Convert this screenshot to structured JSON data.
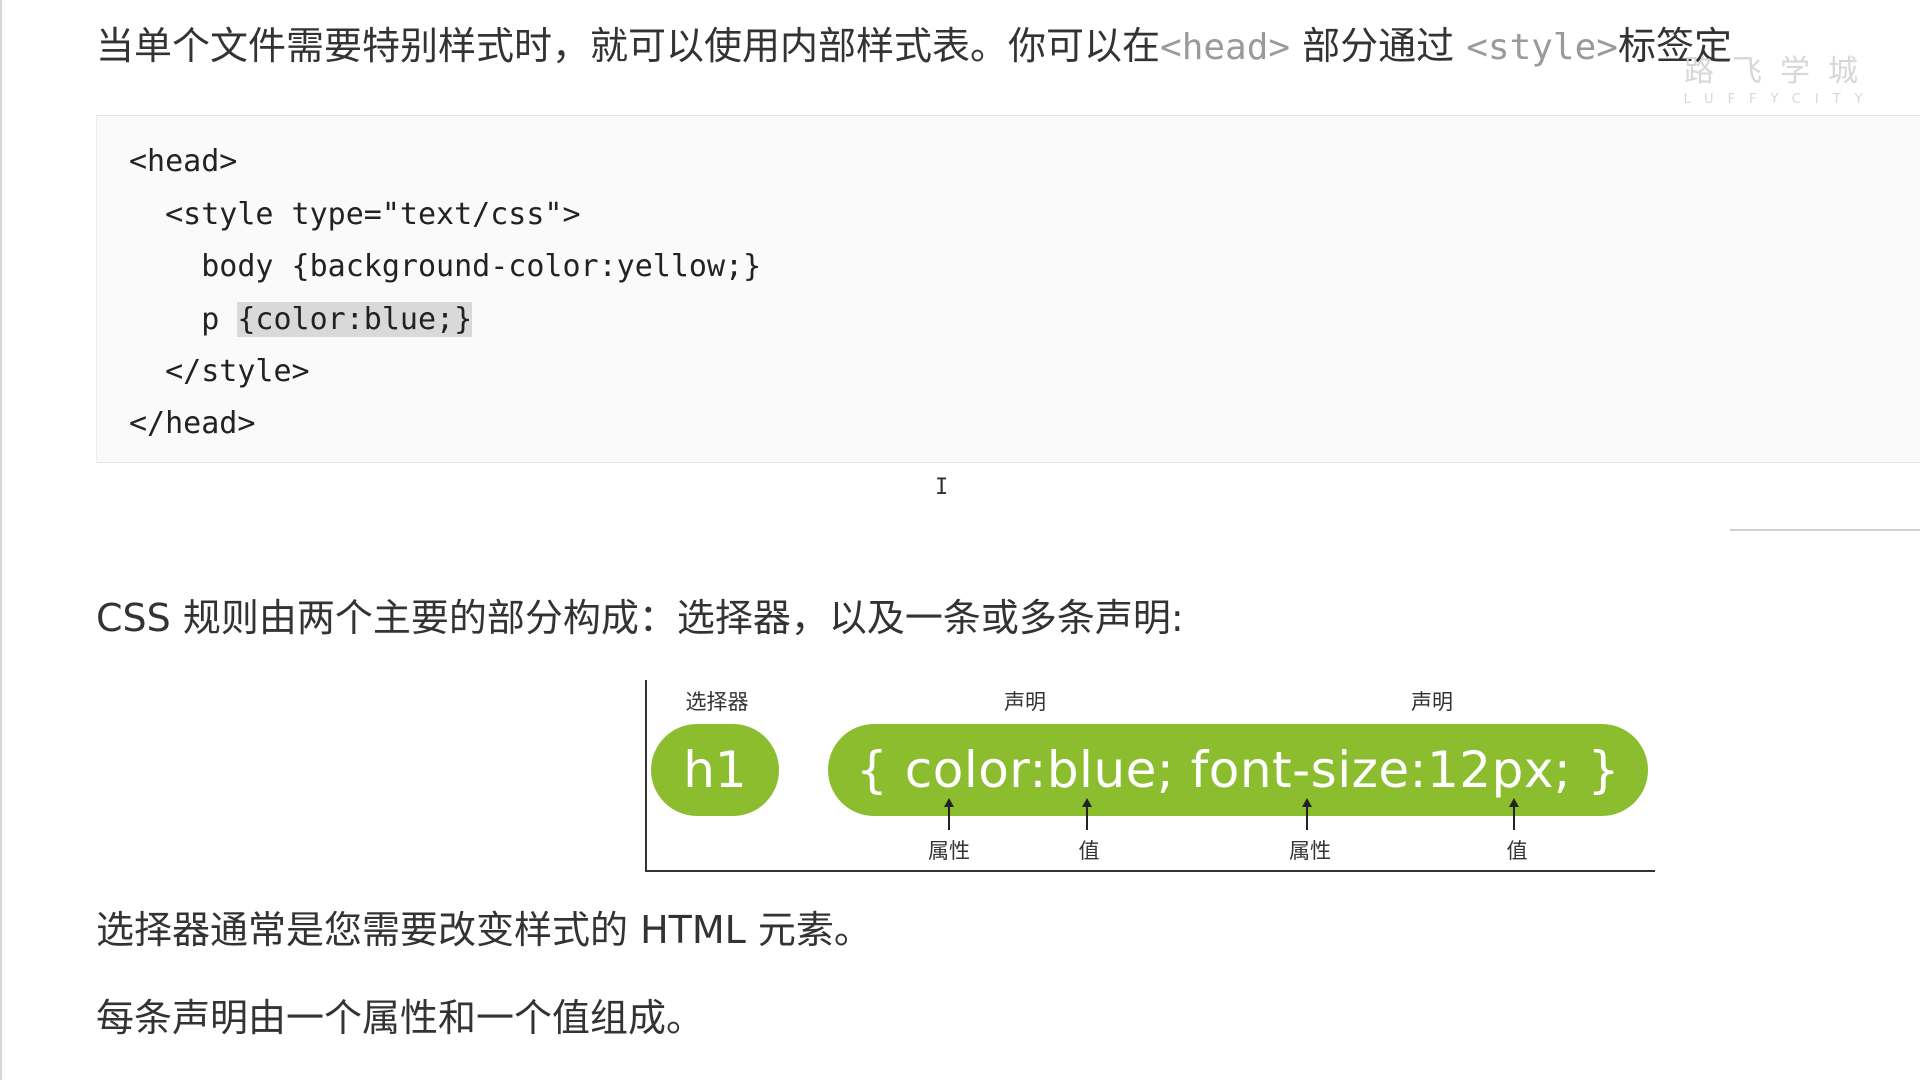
{
  "intro": {
    "text_before_head": "当单个文件需要特别样式时，就可以使用内部样式表。你可以在",
    "head_tag": "<head>",
    "text_middle": " 部分通过 ",
    "style_tag": "<style>",
    "text_after": "标签定"
  },
  "watermark": {
    "cn": "路飞学城",
    "en": "LUFFYCITY"
  },
  "code_block": {
    "lines": [
      "<head>",
      "  <style type=\"text/css\">",
      "    body {background-color:yellow;}",
      "    p ",
      "  </style>",
      "</head>"
    ],
    "highlighted": "{color:blue;}"
  },
  "cursor": {
    "glyph": "I"
  },
  "paragraphs": {
    "rule": "CSS 规则由两个主要的部分构成：选择器，以及一条或多条声明:",
    "selector": "选择器通常是您需要改变样式的 HTML 元素。",
    "declaration": "每条声明由一个属性和一个值组成。"
  },
  "diagram": {
    "label_selector": "选择器",
    "label_decl_1": "声明",
    "label_decl_2": "声明",
    "selector_text": "h1",
    "declaration_text": "{ color:blue; font-size:12px; }",
    "label_prop_1": "属性",
    "label_value_1": "值",
    "label_prop_2": "属性",
    "label_value_2": "值",
    "pill_color": "#8bbd2f"
  }
}
